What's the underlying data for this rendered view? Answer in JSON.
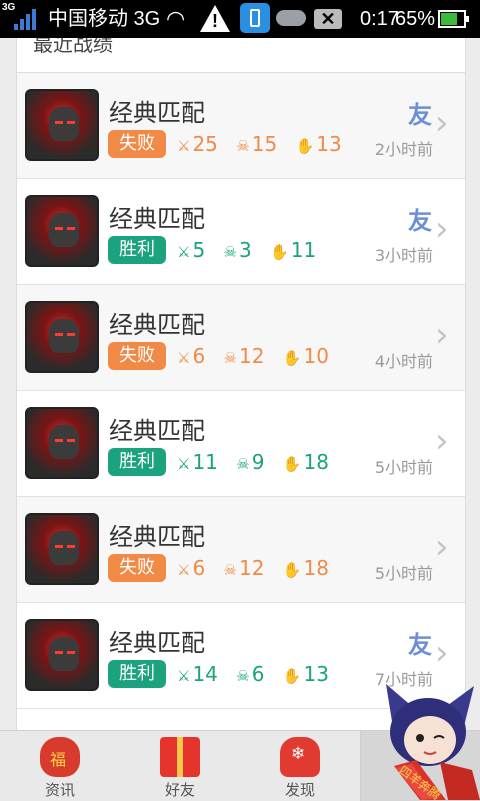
{
  "status_bar": {
    "network_tag": "3G",
    "carrier": "中国移动 3G",
    "time": "0:17",
    "battery": "65%",
    "icons": [
      "signal-icon",
      "wifi-icon",
      "warning-icon",
      "usb-icon",
      "weather-icon",
      "clear-icon",
      "battery-icon"
    ]
  },
  "list": {
    "header_partial": "最近战绩",
    "rows": [
      {
        "title": "经典匹配",
        "result": "失败",
        "result_type": "loss",
        "kills": "25",
        "deaths": "15",
        "assists": "13",
        "time_ago": "2小时前",
        "friend": "友"
      },
      {
        "title": "经典匹配",
        "result": "胜利",
        "result_type": "win",
        "kills": "5",
        "deaths": "3",
        "assists": "11",
        "time_ago": "3小时前",
        "friend": "友"
      },
      {
        "title": "经典匹配",
        "result": "失败",
        "result_type": "loss",
        "kills": "6",
        "deaths": "12",
        "assists": "10",
        "time_ago": "4小时前",
        "friend": ""
      },
      {
        "title": "经典匹配",
        "result": "胜利",
        "result_type": "win",
        "kills": "11",
        "deaths": "9",
        "assists": "18",
        "time_ago": "5小时前",
        "friend": ""
      },
      {
        "title": "经典匹配",
        "result": "失败",
        "result_type": "loss",
        "kills": "6",
        "deaths": "12",
        "assists": "18",
        "time_ago": "5小时前",
        "friend": ""
      },
      {
        "title": "经典匹配",
        "result": "胜利",
        "result_type": "win",
        "kills": "14",
        "deaths": "6",
        "assists": "13",
        "time_ago": "7小时前",
        "friend": "友"
      }
    ]
  },
  "nav": {
    "tabs": [
      {
        "label": "资讯",
        "icon": "lucky-bag-icon"
      },
      {
        "label": "好友",
        "icon": "gift-box-icon"
      },
      {
        "label": "发现",
        "icon": "mitten-icon"
      },
      {
        "label": "",
        "icon": "mascot-icon"
      }
    ],
    "mascot_text": "四羊奔腾",
    "active_index": 3
  },
  "colors": {
    "loss": "#f28a47",
    "win": "#1aa37e",
    "friend": "#6d8fd6"
  }
}
